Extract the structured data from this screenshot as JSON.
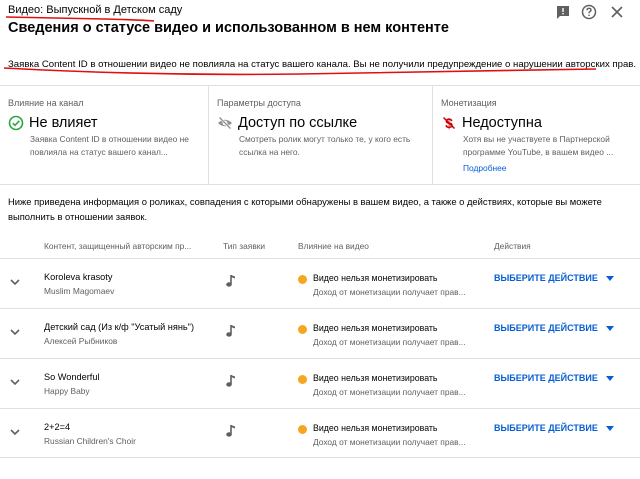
{
  "header": {
    "video_line": "Видео: Выпускной в Детском саду",
    "title": "Сведения о статусе видео и использованном в нем контенте",
    "icons": [
      "feedback-icon",
      "help-icon",
      "close-icon"
    ]
  },
  "notice": "Заявка Content ID в отношении видео не повлияла на статус вашего канала. Вы не получили предупреждение о нарушении авторских прав.",
  "cards": [
    {
      "label": "Влияние на канал",
      "icon": "check-circle-icon",
      "value": "Не влияет",
      "description": "Заявка Content ID в отношении видео не повлияла на статус вашего канал..."
    },
    {
      "label": "Параметры доступа",
      "icon": "eye-off-icon",
      "value": "Доступ по ссылке",
      "description": "Смотреть ролик могут только те, у кого есть ссылка на него."
    },
    {
      "label": "Монетизация",
      "icon": "dollar-off-icon",
      "value": "Недоступна",
      "description": "Хотя вы не участвуете в Партнерской программе YouTube, в вашем видео ...",
      "link": "Подробнее"
    }
  ],
  "info_text": "Ниже приведена информация о роликах, совпадения с которыми обнаружены в вашем видео, а также о действиях, которые вы можете выполнить в отношении заявок.",
  "table": {
    "headers": {
      "content": "Контент, защищенный авторским пр...",
      "claim_type": "Тип заявки",
      "impact": "Влияние на видео",
      "actions": "Действия"
    },
    "rows": [
      {
        "title": "Koroleva krasoty",
        "author": "Muslim Magomaev",
        "claim_icon": "music-note-icon",
        "impact": "Видео нельзя монетизировать",
        "impact_sub": "Доход от монетизации получает прав...",
        "action": "ВЫБЕРИТЕ ДЕЙСТВИЕ"
      },
      {
        "title": "Детский сад (Из к/ф \"Усатый нянь\")",
        "author": "Алексей Рыбников",
        "claim_icon": "music-note-icon",
        "impact": "Видео нельзя монетизировать",
        "impact_sub": "Доход от монетизации получает прав...",
        "action": "ВЫБЕРИТЕ ДЕЙСТВИЕ"
      },
      {
        "title": "So Wonderful",
        "author": "Happy Baby",
        "claim_icon": "music-note-icon",
        "impact": "Видео нельзя монетизировать",
        "impact_sub": "Доход от монетизации получает прав...",
        "action": "ВЫБЕРИТЕ ДЕЙСТВИЕ"
      },
      {
        "title": "2+2=4",
        "author": "Russian Children's Choir",
        "claim_icon": "music-note-icon",
        "impact": "Видео нельзя монетизировать",
        "impact_sub": "Доход от монетизации получает прав...",
        "action": "ВЫБЕРИТЕ ДЕЙСТВИЕ"
      }
    ]
  },
  "colors": {
    "accent_blue": "#065fd4",
    "success_green": "#2ba640",
    "warning_yellow": "#f5a623",
    "monetization_red": "#cc0000",
    "annotation_red": "#e01010"
  }
}
